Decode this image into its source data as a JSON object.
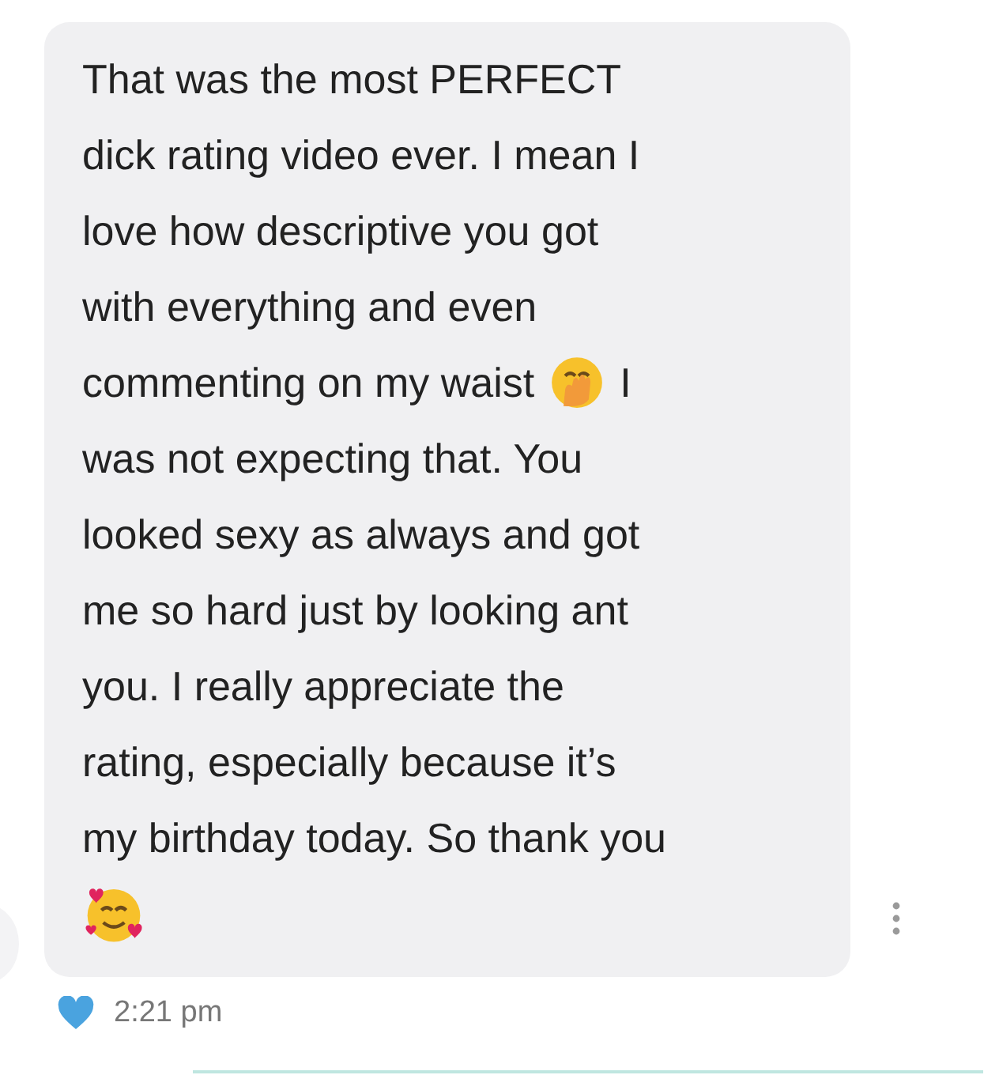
{
  "message": {
    "lines": [
      [
        {
          "kind": "text",
          "text": "That was the most PERFECT"
        }
      ],
      [
        {
          "kind": "text",
          "text": "dick rating video ever. I mean I"
        }
      ],
      [
        {
          "kind": "text",
          "text": "love how descriptive you got"
        }
      ],
      [
        {
          "kind": "text",
          "text": "with everything and even"
        }
      ],
      [
        {
          "kind": "text",
          "text": "commenting on my waist"
        },
        {
          "kind": "shy"
        },
        {
          "kind": "text",
          "text": "I"
        }
      ],
      [
        {
          "kind": "text",
          "text": "was not expecting that. You"
        }
      ],
      [
        {
          "kind": "text",
          "text": "looked sexy as always and got"
        }
      ],
      [
        {
          "kind": "text",
          "text": "me so hard just by looking ant"
        }
      ],
      [
        {
          "kind": "text",
          "text": "you. I really appreciate the"
        }
      ],
      [
        {
          "kind": "text",
          "text": "rating, especially because it’s"
        }
      ],
      [
        {
          "kind": "text",
          "text": "my birthday today. So thank you"
        }
      ],
      [
        {
          "kind": "love"
        }
      ]
    ],
    "liked": true,
    "time": "2:21 pm"
  }
}
